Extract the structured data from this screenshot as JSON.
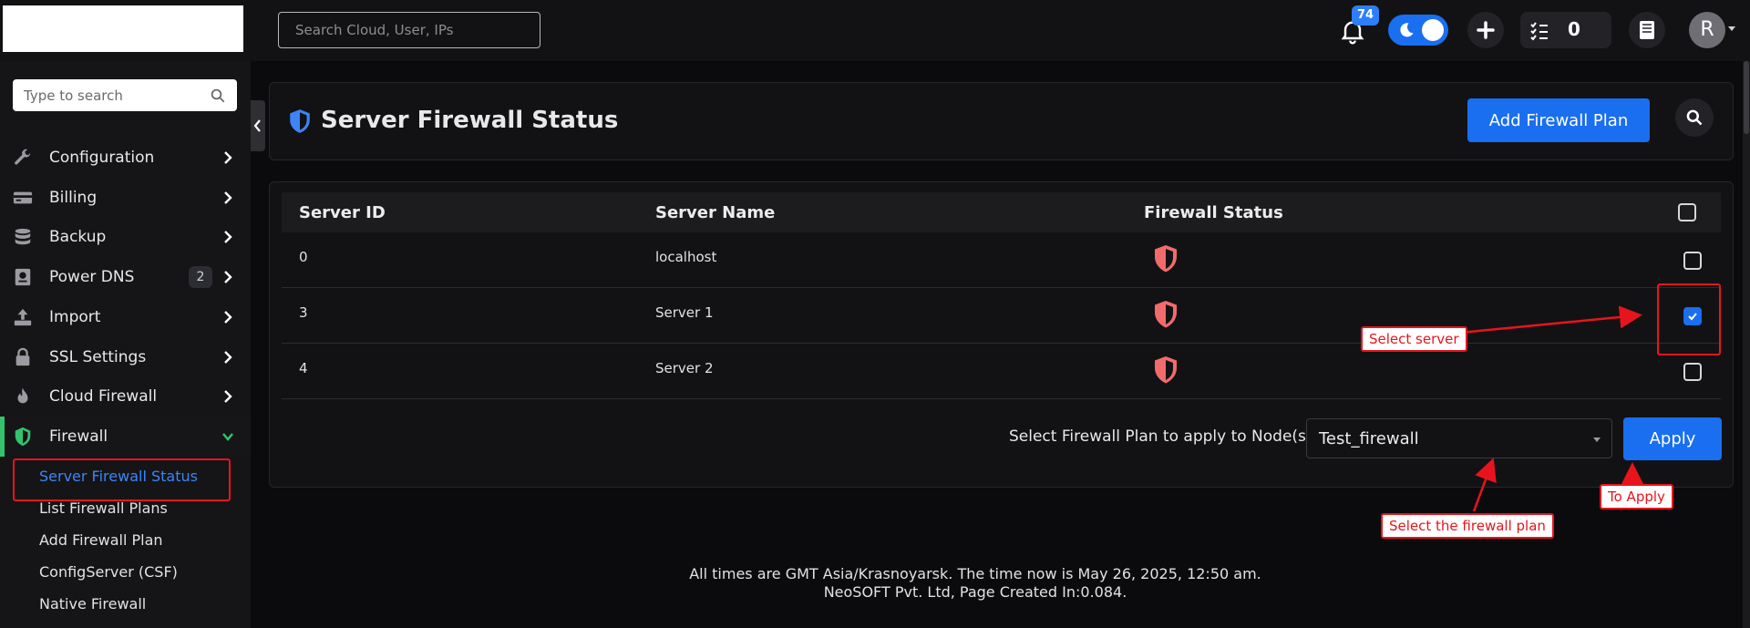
{
  "topbar": {
    "search_placeholder": "Search Cloud, User, IPs",
    "notification_count": "74",
    "task_count": "0",
    "avatar_initial": "R"
  },
  "sidebar": {
    "search_placeholder": "Type to search",
    "items": [
      {
        "label": "Configuration",
        "icon": "wrench-icon"
      },
      {
        "label": "Billing",
        "icon": "billing-icon"
      },
      {
        "label": "Backup",
        "icon": "database-icon"
      },
      {
        "label": "Power DNS",
        "icon": "dns-icon",
        "badge": "2"
      },
      {
        "label": "Import",
        "icon": "upload-icon"
      },
      {
        "label": "SSL Settings",
        "icon": "lock-icon"
      },
      {
        "label": "Cloud Firewall",
        "icon": "flame-icon"
      },
      {
        "label": "Firewall",
        "icon": "shield-icon"
      }
    ],
    "submenu": [
      "Server Firewall Status",
      "List Firewall Plans",
      "Add Firewall Plan",
      "ConfigServer (CSF)",
      "Native Firewall"
    ]
  },
  "page": {
    "title": "Server Firewall Status",
    "add_button": "Add Firewall Plan"
  },
  "table": {
    "headers": [
      "Server ID",
      "Server Name",
      "Firewall Status"
    ],
    "rows": [
      {
        "id": "0",
        "name": "localhost",
        "checked": false
      },
      {
        "id": "3",
        "name": "Server 1",
        "checked": true
      },
      {
        "id": "4",
        "name": "Server 2",
        "checked": false
      }
    ]
  },
  "apply": {
    "label": "Select Firewall Plan to apply to Node(s)",
    "selected_plan": "Test_firewall",
    "button": "Apply"
  },
  "footer": {
    "line1": "All times are GMT Asia/Krasnoyarsk. The time now is May 26, 2025, 12:50 am.",
    "line2": "NeoSOFT Pvt. Ltd, Page Created In:0.084."
  },
  "annotations": {
    "select_server": "Select server",
    "select_plan": "Select the firewall plan",
    "to_apply": "To Apply"
  },
  "colors": {
    "accent": "#1a6ef0",
    "active_green": "#33c36d",
    "shield_red": "#f26b6b",
    "annotation_red": "#e8141d"
  }
}
